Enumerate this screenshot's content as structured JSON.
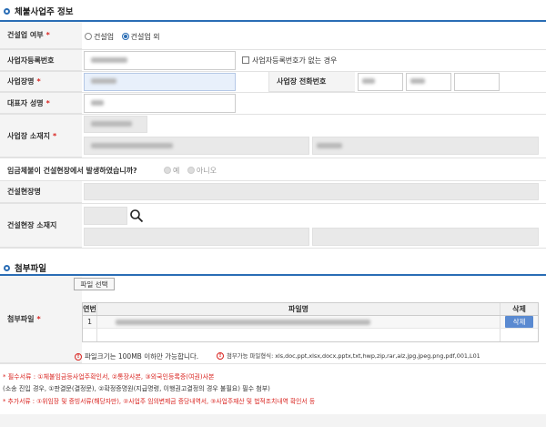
{
  "section1": {
    "title": "체불사업주 정보"
  },
  "construction": {
    "label": "건설업 여부",
    "opt_yes": "건설업",
    "opt_no": "건설업 외"
  },
  "bizno": {
    "label": "사업자등록번호",
    "none_label": "사업자등록번호가 없는 경우"
  },
  "bizname": {
    "label": "사업장명",
    "phone_label": "사업장 전화번호"
  },
  "rep": {
    "label": "대표자 성명"
  },
  "addr": {
    "label": "사업장 소재지"
  },
  "site_q": {
    "label": "임금체불이 건설현장에서 발생하였습니까?",
    "opt_yes": "예",
    "opt_no": "아니오"
  },
  "site_name": {
    "label": "건설현장명"
  },
  "site_addr": {
    "label": "건설현장 소재지"
  },
  "section2": {
    "title": "첨부파일"
  },
  "attach": {
    "label": "첨부파일",
    "select_button": "파일 선택",
    "col_no": "연번",
    "col_name": "파일명",
    "col_del": "삭제",
    "rows": [
      {
        "no": "1",
        "del_label": "삭제"
      }
    ],
    "info_size": "파일크기는 100MB 이하만 가능합니다.",
    "info_types": "첨부가능 파일형식: xls,doc,ppt,xlsx,docx,pptx,txt,hwp,zip,rar,alz,jpg,jpeg,png,pdf,001,L01"
  },
  "notes": {
    "line1": "* 필수서류 : ①체불임금등사업주확인서, ②통장사본, ③외국인등록증(여권)사본",
    "line2": "(소송 진입 경우, ①판결문(결정문), ②확정증명원(지급명령, 이행권고결정의 경우 불필요) 필수 첨부)",
    "line3": "* 추가서류 : ①위임장 및 증빙서류(해당자만), ②사업주 임의변제금 증당내역서, ③사업주재산 및 법적조치내역 확인서 등"
  },
  "colors": {
    "accent": "#2a6db5",
    "required": "#d9231f",
    "delete_button": "#5a8ad1"
  }
}
